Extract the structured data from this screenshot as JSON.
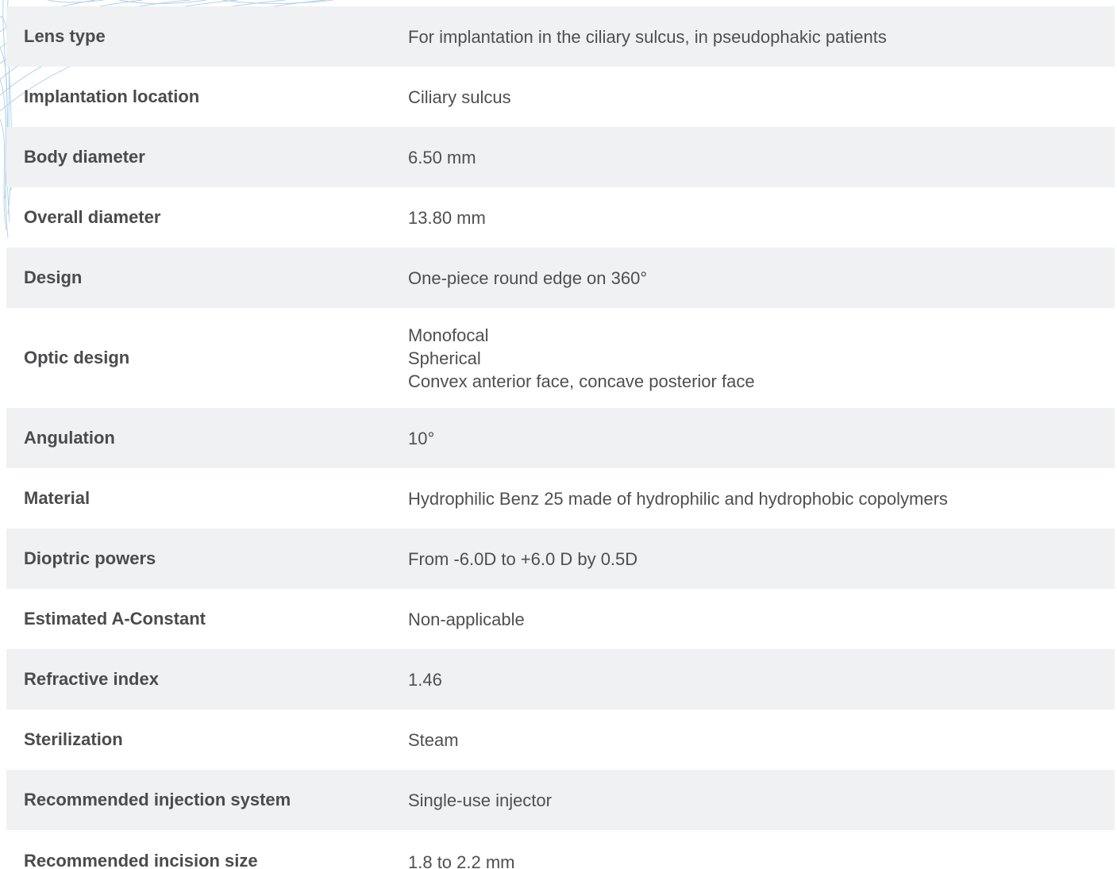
{
  "specifications": [
    {
      "label": "Lens type",
      "value": [
        "For implantation in the ciliary sulcus, in pseudophakic patients"
      ]
    },
    {
      "label": "Implantation location",
      "value": [
        "Ciliary sulcus"
      ]
    },
    {
      "label": "Body diameter",
      "value": [
        "6.50 mm"
      ]
    },
    {
      "label": "Overall diameter",
      "value": [
        "13.80 mm"
      ]
    },
    {
      "label": "Design",
      "value": [
        "One-piece round edge on 360°"
      ]
    },
    {
      "label": "Optic design",
      "value": [
        "Monofocal",
        "Spherical",
        "Convex anterior face, concave posterior face"
      ]
    },
    {
      "label": "Angulation",
      "value": [
        "10°"
      ]
    },
    {
      "label": "Material",
      "value": [
        "Hydrophilic Benz 25 made of hydrophilic and hydrophobic copolymers"
      ]
    },
    {
      "label": "Dioptric powers",
      "value": [
        "From -6.0D to +6.0 D by 0.5D"
      ]
    },
    {
      "label": "Estimated A-Constant",
      "value": [
        "Non-applicable"
      ]
    },
    {
      "label": "Refractive index",
      "value": [
        "1.46"
      ]
    },
    {
      "label": "Sterilization",
      "value": [
        "Steam"
      ]
    },
    {
      "label": "Recommended injection system",
      "value": [
        "Single-use injector"
      ]
    },
    {
      "label": "Recommended incision size",
      "value": [
        "1.8 to 2.2 mm"
      ]
    }
  ],
  "colors": {
    "row_shade": "#f0f1f3",
    "label_text": "#4b4b4d",
    "value_text": "#4f4f51",
    "decoration": "#9cc3e6"
  }
}
